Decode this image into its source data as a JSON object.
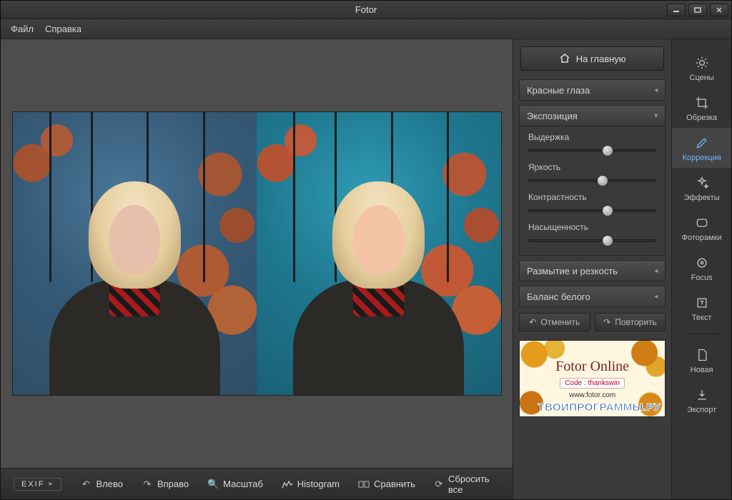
{
  "titlebar": {
    "title": "Fotor"
  },
  "menubar": {
    "file": "Файл",
    "help": "Справка"
  },
  "home_button": "На главную",
  "accordion": {
    "red_eye": "Красные глаза",
    "exposure": "Экспозиция",
    "blur_sharp": "Размытие и резкость",
    "white_balance": "Баланс белого"
  },
  "sliders": {
    "exposure": {
      "label": "Выдержка",
      "value": 62
    },
    "brightness": {
      "label": "Яркость",
      "value": 58
    },
    "contrast": {
      "label": "Контрастность",
      "value": 62
    },
    "saturation": {
      "label": "Насыщенность",
      "value": 62
    }
  },
  "undo": {
    "undo": "Отменить",
    "redo": "Повторить"
  },
  "promo": {
    "title": "Fotor Online",
    "code_label": "Code : thankswin",
    "url": "www.fotor.com",
    "watermark": "ТВОИПРОГРАММЫ.РУ"
  },
  "rail": {
    "scenes": "Сцены",
    "crop": "Обрезка",
    "correction": "Коррекция",
    "effects": "Эффекты",
    "frames": "Фоторамки",
    "focus": "Focus",
    "text": "Текст",
    "new": "Новая",
    "export": "Экспорт"
  },
  "bottombar": {
    "exif": "EXIF",
    "left": "Влево",
    "right": "Вправо",
    "zoom": "Масштаб",
    "histogram": "Histogram",
    "compare": "Сравнить",
    "reset": "Сбросить все"
  }
}
